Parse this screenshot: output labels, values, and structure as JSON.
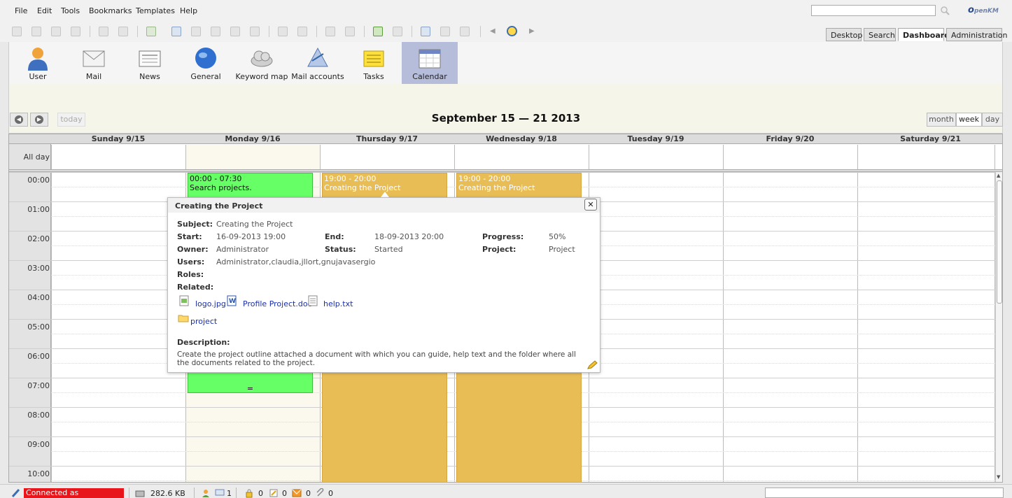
{
  "menu": [
    "File",
    "Edit",
    "Tools",
    "Bookmarks",
    "Templates",
    "Help"
  ],
  "logo": {
    "main": "penKM",
    "prefix": "o"
  },
  "main_tabs": [
    "Desktop",
    "Search",
    "Dashboard",
    "Administration"
  ],
  "active_main_tab": "Dashboard",
  "dashboard": {
    "items": [
      "User",
      "Mail",
      "News",
      "General",
      "Keyword map",
      "Mail accounts",
      "Tasks",
      "Calendar"
    ],
    "active": "Calendar"
  },
  "calendar": {
    "title": "September 15 — 21 2013",
    "today_label": "today",
    "views": [
      "month",
      "week",
      "day"
    ],
    "active_view": "week",
    "allday_label": "All day",
    "columns": [
      "Sunday 9/15",
      "Monday 9/16",
      "Thursday 9/17",
      "Wednesday 9/18",
      "Tuesday 9/19",
      "Friday 9/20",
      "Saturday 9/21"
    ],
    "hours": [
      "00:00",
      "01:00",
      "02:00",
      "03:00",
      "04:00",
      "05:00",
      "06:00",
      "07:00",
      "08:00",
      "09:00",
      "10:00"
    ],
    "events": [
      {
        "time": "00:00 - 07:30",
        "title": "Search projects.",
        "footer": "=",
        "color": "#66ff66"
      },
      {
        "time": "19:00 - 20:00",
        "title": "Creating the Project",
        "color": "#e8bd55"
      },
      {
        "time": "19:00 - 20:00",
        "title": "Creating the Project",
        "color": "#e8bd55"
      }
    ]
  },
  "popup": {
    "title": "Creating the Project",
    "close": "✕",
    "subject_label": "Subject:",
    "subject": "Creating the Project",
    "start_label": "Start:",
    "start": "16-09-2013 19:00",
    "end_label": "End:",
    "end": "18-09-2013 20:00",
    "progress_label": "Progress:",
    "progress": "50%",
    "owner_label": "Owner:",
    "owner": "Administrator",
    "status_label": "Status:",
    "status": "Started",
    "project_label": "Project:",
    "project": "Project",
    "users_label": "Users:",
    "users": "Administrator,claudia,jllort,gnujavasergio",
    "roles_label": "Roles:",
    "related_label": "Related:",
    "related": [
      "logo.jpg",
      "Profile Project.doc",
      "help.txt"
    ],
    "folder": "project",
    "description_label": "Description:",
    "description": "Create the project outline attached a document with which you can guide, help text and the folder where all the documents related to the project."
  },
  "status": {
    "connected": "Connected as Administrator",
    "size": "282.6 KB",
    "count1": "1",
    "count2": "0",
    "count3": "0",
    "count4": "0",
    "count5": "0"
  },
  "colors": {
    "accent": "#b6bddb",
    "green_event": "#66ff66",
    "orange_event": "#e8bd55",
    "connected": "#e8161a"
  }
}
